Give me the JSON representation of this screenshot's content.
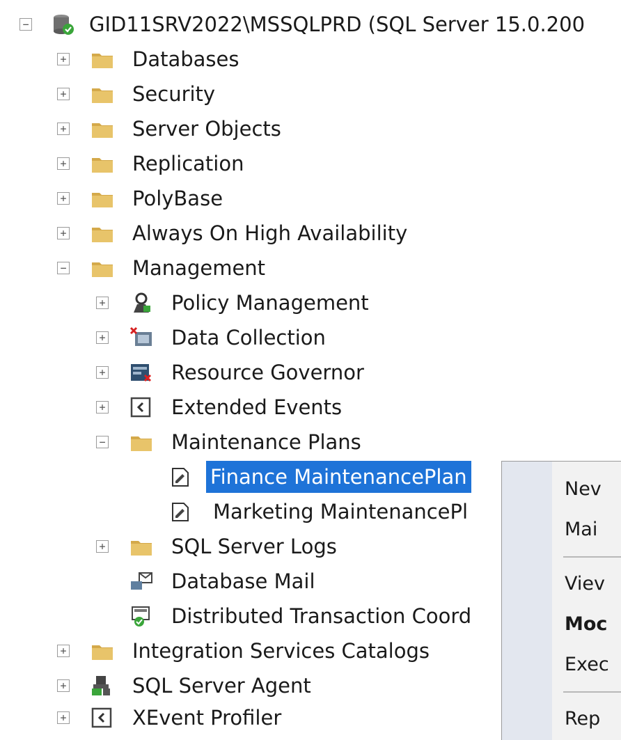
{
  "tree": {
    "server": {
      "label": "GID11SRV2022\\MSSQLPRD (SQL Server 15.0.200"
    },
    "items": [
      {
        "label": "Databases"
      },
      {
        "label": "Security"
      },
      {
        "label": "Server Objects"
      },
      {
        "label": "Replication"
      },
      {
        "label": "PolyBase"
      },
      {
        "label": "Always On High Availability"
      },
      {
        "label": "Management"
      },
      {
        "label": "Policy Management"
      },
      {
        "label": "Data Collection"
      },
      {
        "label": "Resource Governor"
      },
      {
        "label": "Extended Events"
      },
      {
        "label": "Maintenance Plans"
      },
      {
        "label": "Finance MaintenancePlan"
      },
      {
        "label": "Marketing MaintenancePl"
      },
      {
        "label": "SQL Server Logs"
      },
      {
        "label": "Database Mail"
      },
      {
        "label": "Distributed Transaction Coord"
      },
      {
        "label": "Integration Services Catalogs"
      },
      {
        "label": "SQL Server Agent"
      },
      {
        "label": "XEvent Profiler"
      }
    ],
    "expand_glyph": "+",
    "collapse_glyph": "−"
  },
  "context_menu": {
    "items": [
      {
        "label": "Nev"
      },
      {
        "label": "Mai"
      },
      {
        "label": "Viev"
      },
      {
        "label": "Moc"
      },
      {
        "label": "Exec"
      },
      {
        "label": "Rep"
      }
    ]
  },
  "colors": {
    "selection": "#1e73d8",
    "folder": "#e8c46a",
    "folder_dark": "#d4a94a",
    "menu_gutter": "#e3e7ef"
  }
}
